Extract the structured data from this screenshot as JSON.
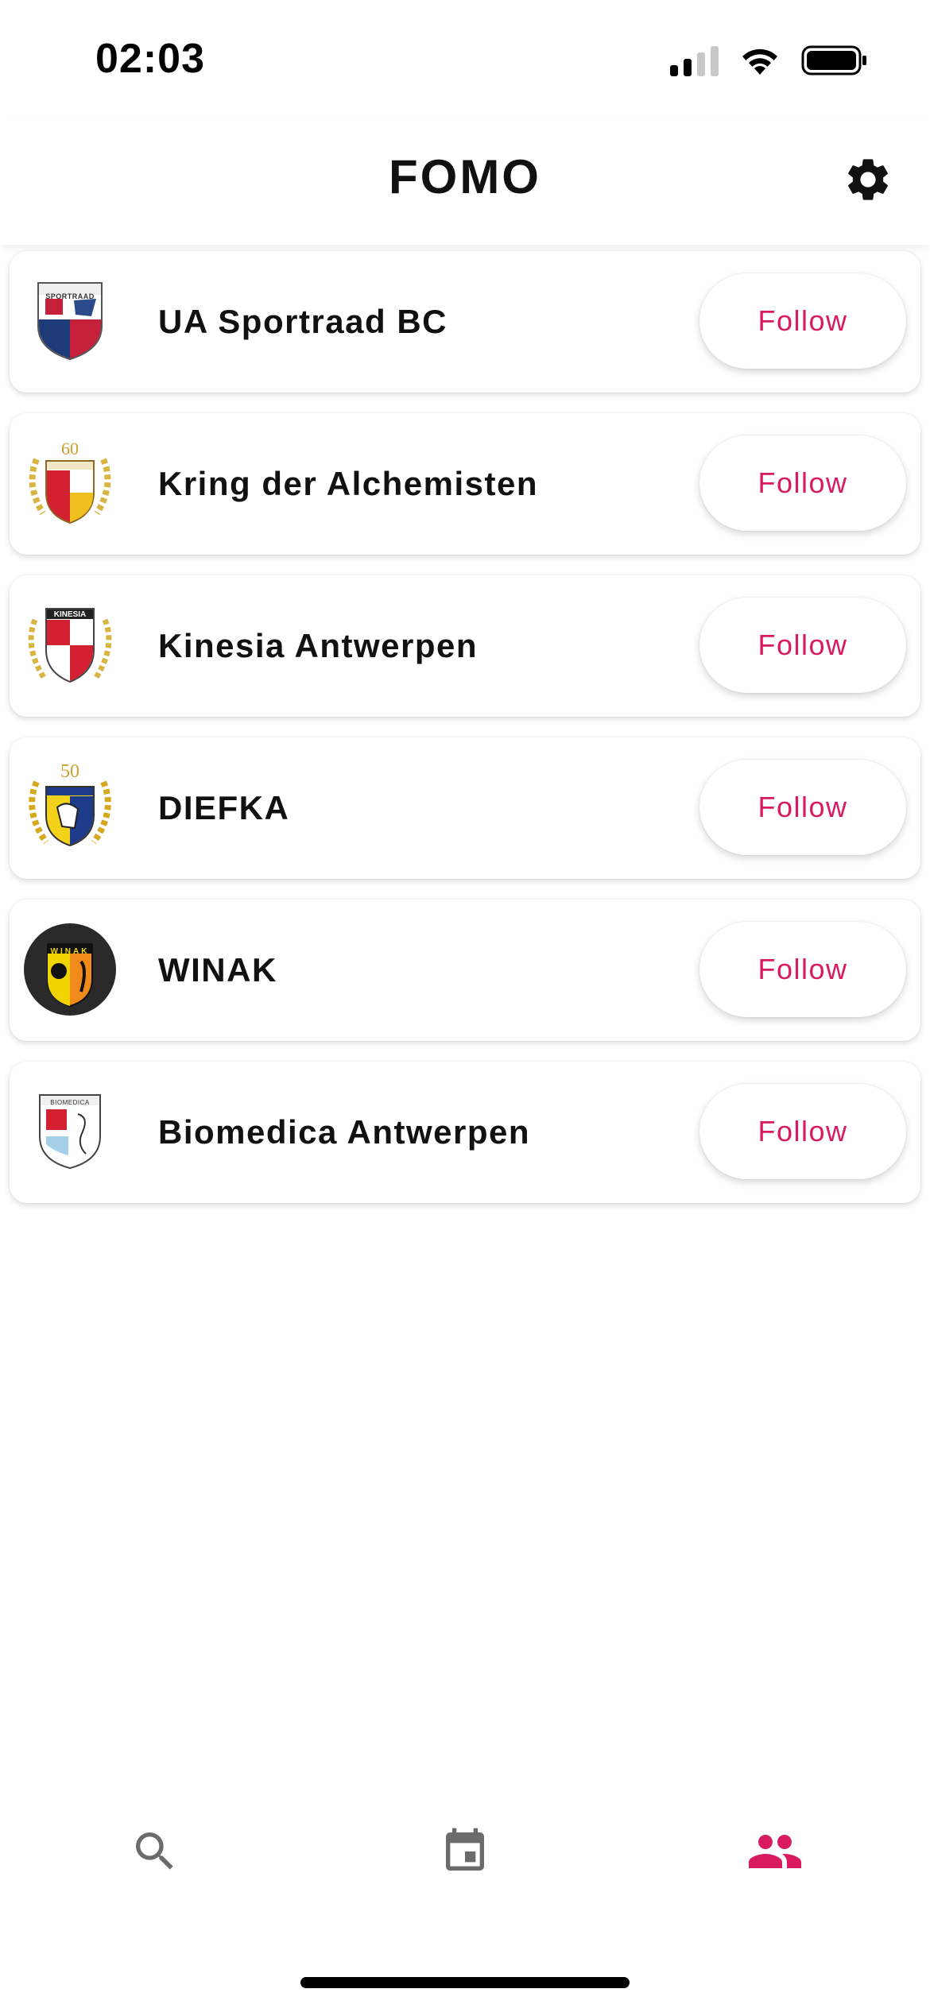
{
  "status_bar": {
    "time": "02:03"
  },
  "header": {
    "title": "FOMO",
    "settings_icon": "gear-icon"
  },
  "clubs": [
    {
      "name": "UA Sportraad BC",
      "follow_label": "Follow",
      "logo_text": "SPORTRAAD"
    },
    {
      "name": "Kring der Alchemisten",
      "follow_label": "Follow",
      "logo_text": "60"
    },
    {
      "name": "Kinesia Antwerpen",
      "follow_label": "Follow",
      "logo_text": "KINESIA"
    },
    {
      "name": "DIEFKA",
      "follow_label": "Follow",
      "logo_text": "50"
    },
    {
      "name": "WINAK",
      "follow_label": "Follow",
      "logo_text": "WINAK"
    },
    {
      "name": "Biomedica Antwerpen",
      "follow_label": "Follow",
      "logo_text": "BIOMEDICA"
    }
  ],
  "bottom_nav": [
    {
      "icon": "search-icon",
      "active": false
    },
    {
      "icon": "calendar-icon",
      "active": false
    },
    {
      "icon": "people-icon",
      "active": true
    }
  ],
  "colors": {
    "accent": "#d81b60",
    "inactive_icon": "#6b6b6b",
    "text": "#111111"
  }
}
